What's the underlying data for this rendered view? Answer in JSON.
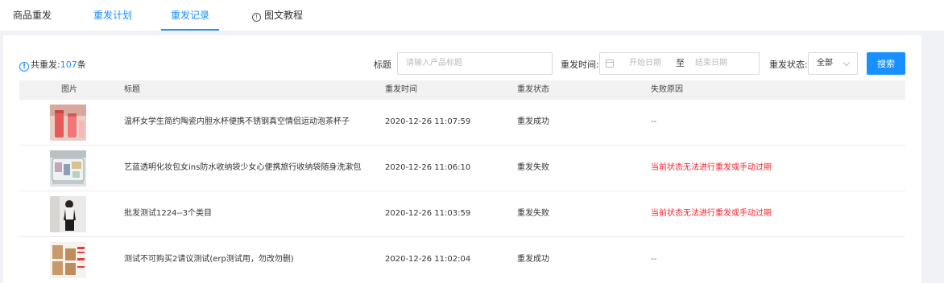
{
  "tabs": [
    {
      "label": "商品重发"
    },
    {
      "label": "重发计划"
    },
    {
      "label": "重发记录"
    },
    {
      "label": "图文教程"
    }
  ],
  "summary": {
    "prefix": "共重发:",
    "count": "107",
    "suffix": "条"
  },
  "filters": {
    "title_label": "标题",
    "title_placeholder": "请输入产品标题",
    "time_label": "重发时间:",
    "start_placeholder": "开始日期",
    "range_sep": "至",
    "end_placeholder": "结束日期",
    "status_label": "重发状态:",
    "status_value": "全部",
    "search_label": "搜索"
  },
  "table": {
    "headers": [
      "图片",
      "标题",
      "重发时间",
      "重发状态",
      "失败原因"
    ],
    "rows": [
      {
        "title": "温杯女学生简约陶瓷内胆水杯便携不锈钢真空情侣运动泡茶杯子",
        "time": "2020-12-26 11:07:59",
        "status": "重发成功",
        "reason": "--"
      },
      {
        "title": "艺蓝透明化妆包女ins防水收纳袋少女心便携旅行收纳袋随身洗漱包",
        "time": "2020-12-26 11:06:10",
        "status": "重发失败",
        "reason": "当前状态无法进行重发或手动过期"
      },
      {
        "title": "批发测试1224--3个类目",
        "time": "2020-12-26 11:03:59",
        "status": "重发失败",
        "reason": "当前状态无法进行重发或手动过期"
      },
      {
        "title": "测试不可购买2请议测试(erp测试用，勿改勿删)",
        "time": "2020-12-26 11:02:04",
        "status": "重发成功",
        "reason": "--"
      }
    ]
  }
}
